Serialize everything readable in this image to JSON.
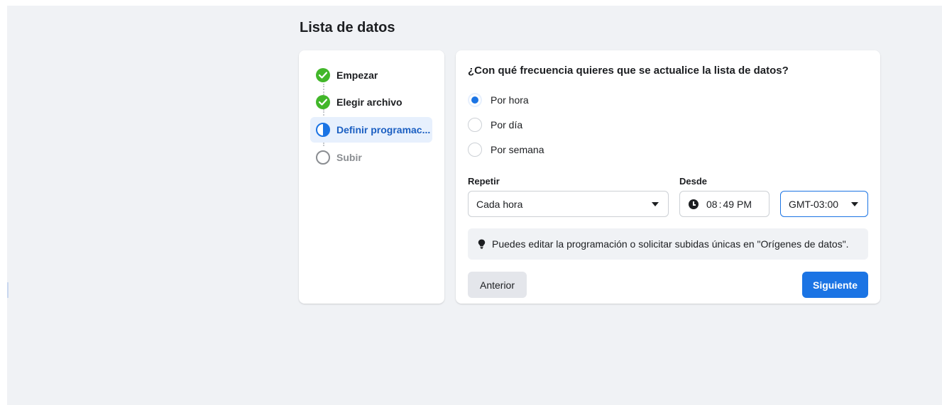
{
  "page_title": "Lista de datos",
  "steps": [
    {
      "label": "Empezar",
      "state": "done",
      "icon": "check-circle-icon"
    },
    {
      "label": "Elegir archivo",
      "state": "done",
      "icon": "check-circle-icon"
    },
    {
      "label": "Definir programac...",
      "state": "active",
      "icon": "half-circle-icon"
    },
    {
      "label": "Subir",
      "state": "pending",
      "icon": "empty-circle-icon"
    }
  ],
  "question": "¿Con qué frecuencia quieres que se actualice la lista de datos?",
  "frequency_options": [
    {
      "label": "Por hora",
      "checked": true
    },
    {
      "label": "Por día",
      "checked": false
    },
    {
      "label": "Por semana",
      "checked": false
    }
  ],
  "repeat": {
    "label": "Repetir",
    "value": "Cada hora"
  },
  "from": {
    "label": "Desde",
    "hour": "08",
    "separator": ":",
    "minute": "49",
    "period": "PM",
    "timezone": "GMT-03:00"
  },
  "tip": {
    "icon": "lightbulb-icon",
    "text": "Puedes editar la programación o solicitar subidas únicas en \"Orígenes de datos\"."
  },
  "buttons": {
    "back": "Anterior",
    "next": "Siguiente"
  },
  "colors": {
    "accent": "#1b74e4",
    "success": "#42b72a",
    "background": "#f0f2f5",
    "active_step_bg": "#e7f0fd"
  }
}
